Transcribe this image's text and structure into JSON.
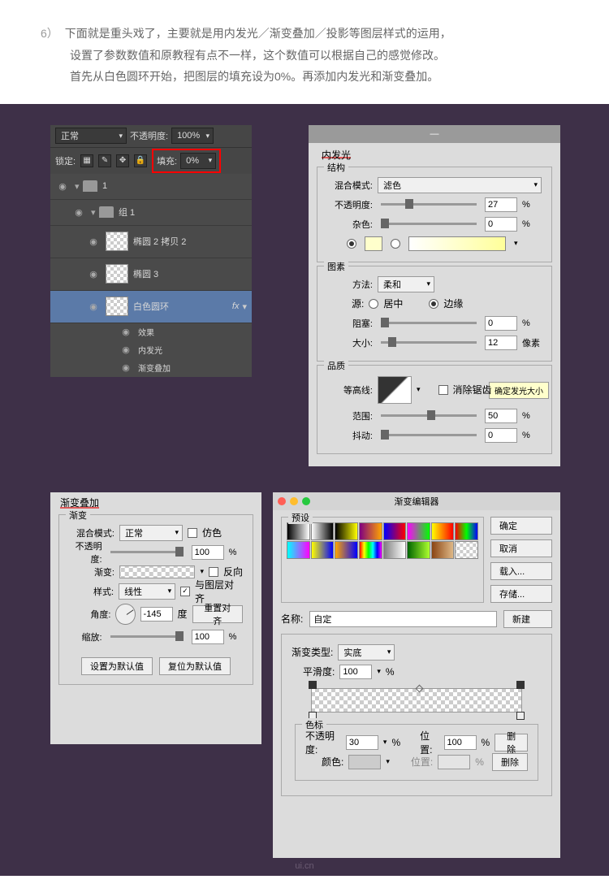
{
  "intro": {
    "step": "6）",
    "line1": "下面就是重头戏了，主要就是用内发光／渐变叠加／投影等图层样式的运用，",
    "line2": "设置了参数数值和原教程有点不一样，这个数值可以根据自己的感觉修改。",
    "line3": "首先从白色圆环开始，把图层的填充设为0%。再添加内发光和渐变叠加。"
  },
  "layers": {
    "blendMode": "正常",
    "opacityLabel": "不透明度:",
    "opacityValue": "100%",
    "lockLabel": "锁定:",
    "fillLabel": "填充:",
    "fillValue": "0%",
    "items": [
      {
        "name": "1",
        "type": "folder"
      },
      {
        "name": "组 1",
        "type": "folder"
      },
      {
        "name": "椭圆 2 拷贝 2",
        "type": "shape"
      },
      {
        "name": "椭圆 3",
        "type": "shape"
      },
      {
        "name": "白色圆环",
        "type": "shape",
        "selected": true,
        "fx": "fx"
      }
    ],
    "effects": {
      "label": "效果",
      "items": [
        "内发光",
        "渐变叠加"
      ]
    }
  },
  "innerGlow": {
    "title": "内发光",
    "struct": {
      "legend": "结构",
      "blendModeLabel": "混合模式:",
      "blendModeValue": "滤色",
      "opacityLabel": "不透明度:",
      "opacityValue": "27",
      "pct": "%",
      "noiseLabel": "杂色:",
      "noiseValue": "0"
    },
    "elements": {
      "legend": "图素",
      "methodLabel": "方法:",
      "methodValue": "柔和",
      "sourceLabel": "源:",
      "centerLabel": "居中",
      "edgeLabel": "边缘",
      "chokeLabel": "阻塞:",
      "chokeValue": "0",
      "sizeLabel": "大小:",
      "sizeValue": "12",
      "px": "像素"
    },
    "quality": {
      "legend": "品质",
      "contourLabel": "等高线:",
      "antiAliasLabel": "消除锯齿",
      "rangeLabel": "范围:",
      "rangeValue": "50",
      "jitterLabel": "抖动:",
      "jitterValue": "0"
    },
    "tooltip": "确定发光大小"
  },
  "gradientOverlay": {
    "title": "渐变叠加",
    "subtitle": "渐变",
    "blendModeLabel": "混合模式:",
    "blendModeValue": "正常",
    "ditherLabel": "仿色",
    "opacityLabel": "不透明度:",
    "opacityValue": "100",
    "pct": "%",
    "gradientLabel": "渐变:",
    "reverseLabel": "反向",
    "styleLabel": "样式:",
    "styleValue": "线性",
    "alignLabel": "与图层对齐",
    "angleLabel": "角度:",
    "angleValue": "-145",
    "deg": "度",
    "resetAlign": "重置对齐",
    "scaleLabel": "缩放:",
    "scaleValue": "100",
    "setDefault": "设置为默认值",
    "resetDefault": "复位为默认值"
  },
  "gradientEditor": {
    "title": "渐变编辑器",
    "presetsLabel": "预设",
    "buttons": {
      "ok": "确定",
      "cancel": "取消",
      "load": "载入...",
      "save": "存储..."
    },
    "nameLabel": "名称:",
    "nameValue": "自定",
    "newBtn": "新建",
    "typeLabel": "渐变类型:",
    "typeValue": "实底",
    "smoothLabel": "平滑度:",
    "smoothValue": "100",
    "pct": "%",
    "stops": {
      "legend": "色标",
      "opacityLabel": "不透明度:",
      "opacityValue": "30",
      "locationLabel": "位置:",
      "locationValue": "100",
      "colorLabel": "颜色:",
      "locationLabel2": "位置:",
      "deleteBtn": "删除"
    },
    "presetColors": [
      "linear-gradient(to right,#000,#fff)",
      "linear-gradient(to right,#fff,#000)",
      "linear-gradient(to right,#000,#ff0)",
      "linear-gradient(to right,#800080,#ffa500)",
      "linear-gradient(to right,#00f,#f00)",
      "linear-gradient(to right,#f0f,#0f0)",
      "linear-gradient(to right,#ff0,#f00)",
      "linear-gradient(to right,#f00,#0f0,#00f)",
      "linear-gradient(to right,#0ff,#f0f)",
      "linear-gradient(to right,#ff0,#00f)",
      "linear-gradient(to right,#ffa500,#0000ff)",
      "linear-gradient(to right,#f00,#ff0,#0f0,#0ff,#00f,#f0f)",
      "linear-gradient(to right,#808080,#fff)",
      "linear-gradient(to right,#006400,#adff2f)",
      "linear-gradient(to right,#8b4513,#deb887)",
      "repeating-conic-gradient(#fff 0 25%, #ccc 0 50%) 50%/8px 8px"
    ]
  },
  "watermark": "ui.cn"
}
